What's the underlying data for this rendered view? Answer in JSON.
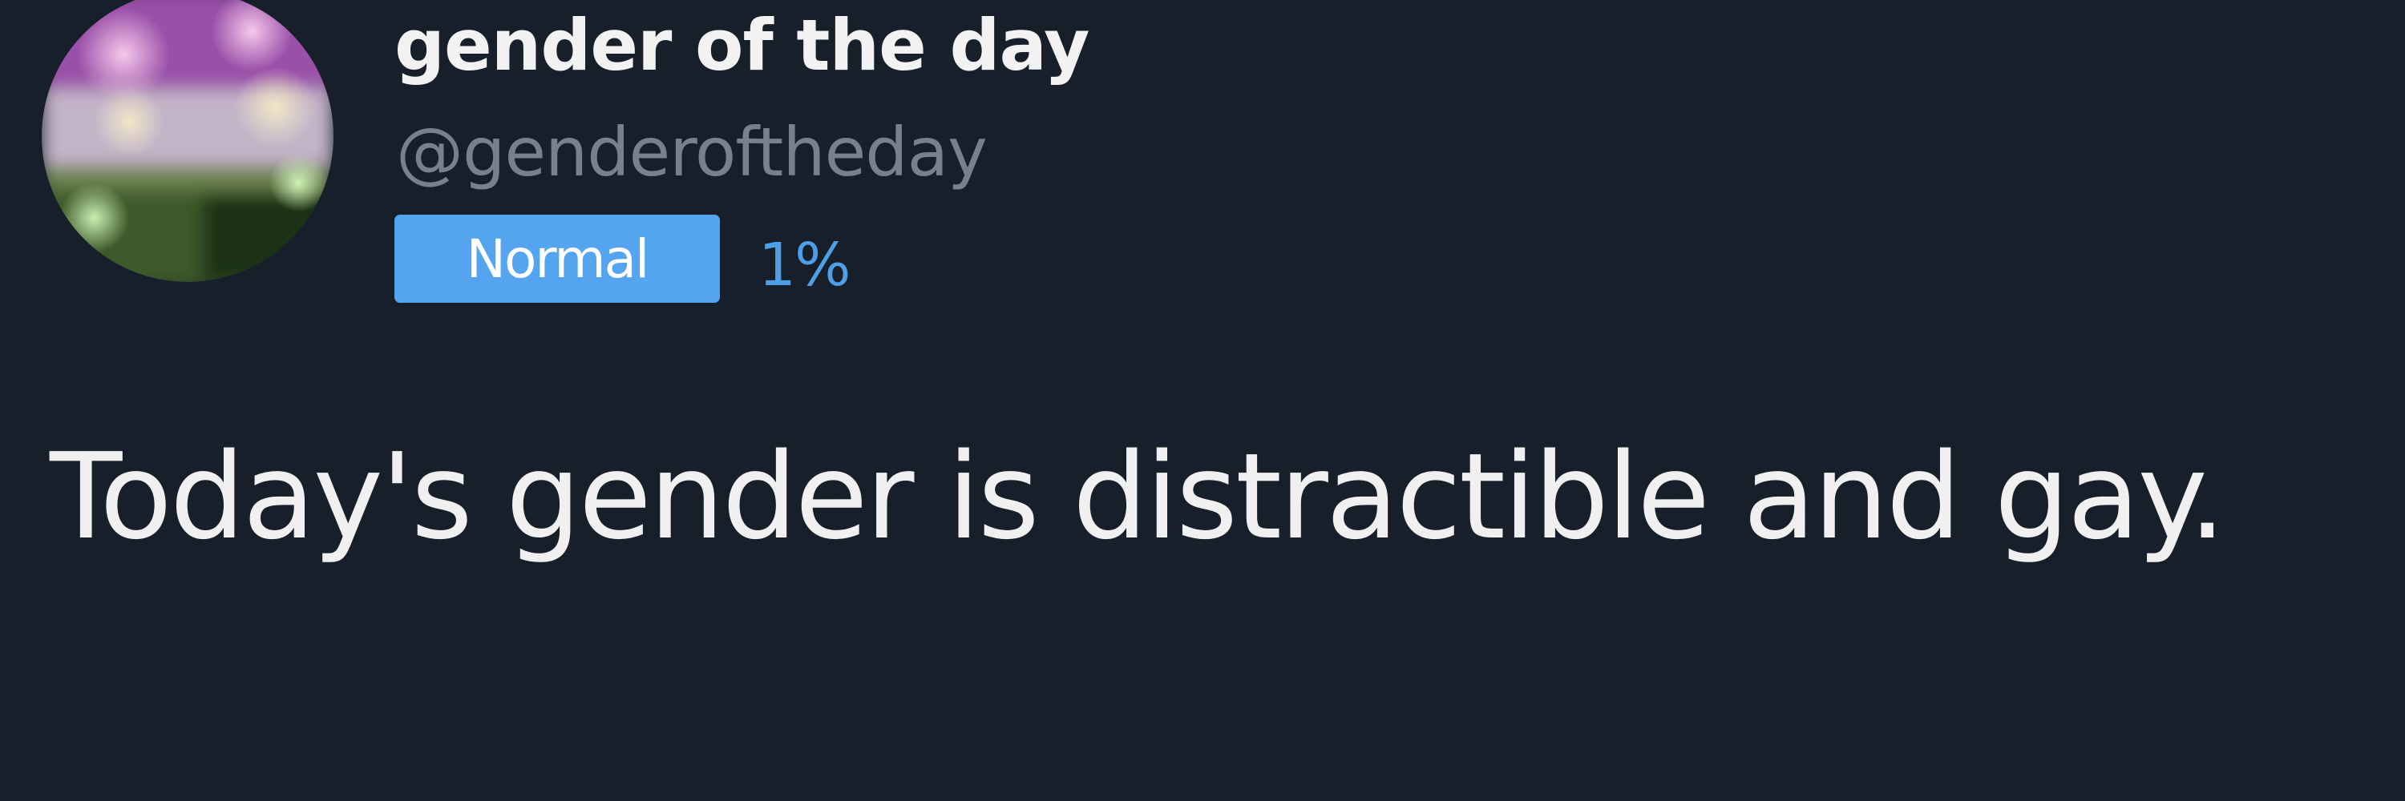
{
  "tweet": {
    "author": {
      "display_name": "gender of the day",
      "handle": "@genderoftheday",
      "avatar": "gender-flag-avatar"
    },
    "badge": {
      "label": "Normal",
      "percent": "1%",
      "color": "#55a4ef"
    },
    "text": "Today's gender is distractible and gay."
  },
  "colors": {
    "background": "#161f2a",
    "text": "#f0f0f0",
    "handle": "#77818c",
    "accent": "#55a4ef"
  }
}
